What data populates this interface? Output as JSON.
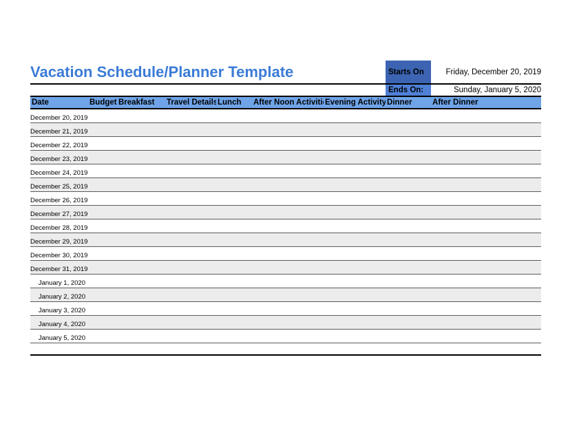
{
  "title": "Vacation Schedule/Planner Template",
  "meta": {
    "starts_label": "Starts On",
    "starts_value": "Friday, December 20, 2019",
    "ends_label": "Ends On:",
    "ends_value": "Sunday, January 5, 2020"
  },
  "columns": {
    "date": "Date",
    "budget": "Budget",
    "breakfast": "Breakfast",
    "travel": "Travel Details",
    "lunch": "Lunch",
    "afternoon": "After Noon Activities",
    "evening": "Evening Activity",
    "dinner": "Dinner",
    "after_dinner": "After Dinner"
  },
  "rows": [
    {
      "date": "December 20, 2019"
    },
    {
      "date": "December 21, 2019"
    },
    {
      "date": "December 22, 2019"
    },
    {
      "date": "December 23, 2019"
    },
    {
      "date": "December 24, 2019"
    },
    {
      "date": "December 25, 2019"
    },
    {
      "date": "December 26, 2019"
    },
    {
      "date": "December 27, 2019"
    },
    {
      "date": "December 28, 2019"
    },
    {
      "date": "December 29, 2019"
    },
    {
      "date": "December 30, 2019"
    },
    {
      "date": "December 31, 2019"
    },
    {
      "date": "January 1, 2020"
    },
    {
      "date": "January 2, 2020"
    },
    {
      "date": "January 3, 2020"
    },
    {
      "date": "January 4, 2020"
    },
    {
      "date": "January 5, 2020"
    }
  ]
}
